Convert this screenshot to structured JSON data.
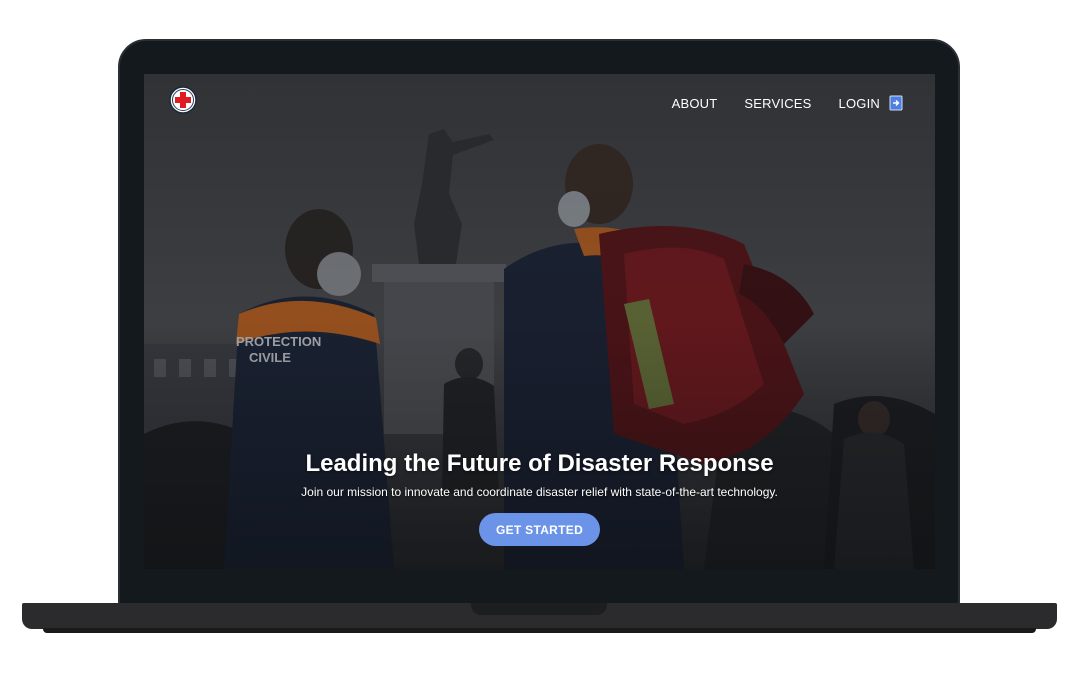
{
  "brand": {
    "logo_icon": "red-cross-icon",
    "accent": "#e11b22"
  },
  "nav": {
    "items": [
      {
        "label": "ABOUT"
      },
      {
        "label": "SERVICES"
      }
    ],
    "login": {
      "label": "LOGIN",
      "icon": "login-icon"
    }
  },
  "hero": {
    "background": "photo-rescue-workers-crowd",
    "title": "Leading the Future of Disaster Response",
    "subtitle": "Join our mission to innovate and coordinate disaster relief with state-of-the-art technology.",
    "cta_label": "GET STARTED",
    "cta_color": "#6b93e8"
  }
}
